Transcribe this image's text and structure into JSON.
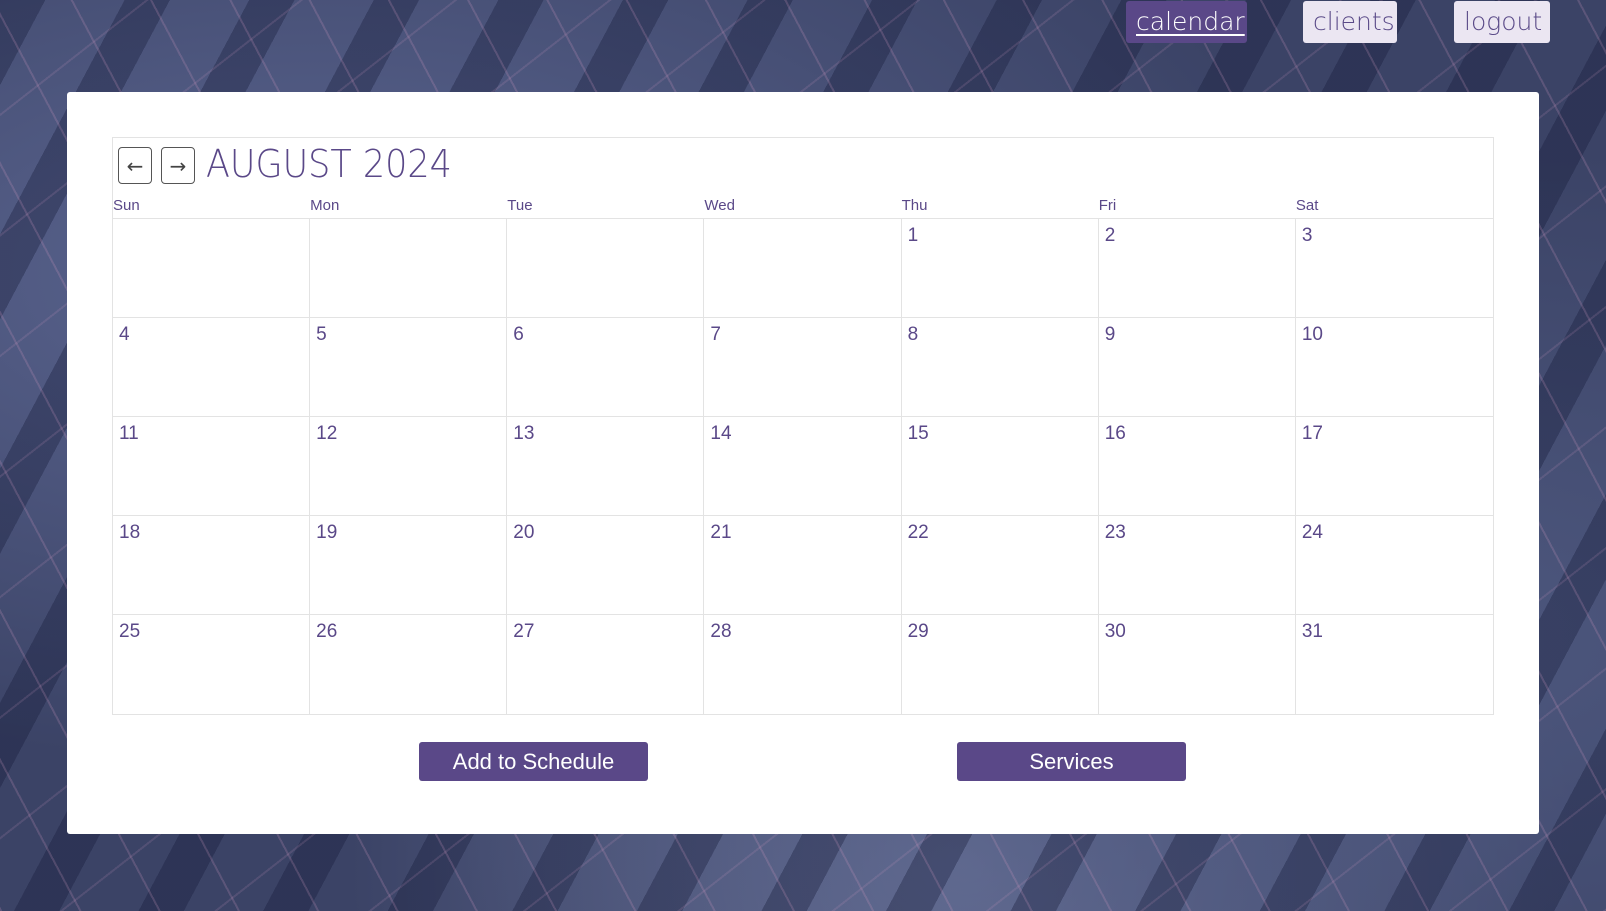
{
  "nav": {
    "calendar_label": "calendar",
    "clients_label": "clients",
    "logout_label": "logout"
  },
  "calendar": {
    "month_title": "AUGUST 2024",
    "prev_arrow": "←",
    "next_arrow": "→",
    "weekdays": [
      "Sun",
      "Mon",
      "Tue",
      "Wed",
      "Thu",
      "Fri",
      "Sat"
    ],
    "leading_blank_days": 4,
    "days_in_month": 31
  },
  "actions": {
    "add_schedule_label": "Add to Schedule",
    "services_label": "Services"
  },
  "colors": {
    "accent": "#5a4888",
    "nav_inactive_bg": "#ebe6f2",
    "card_bg": "#ffffff"
  }
}
